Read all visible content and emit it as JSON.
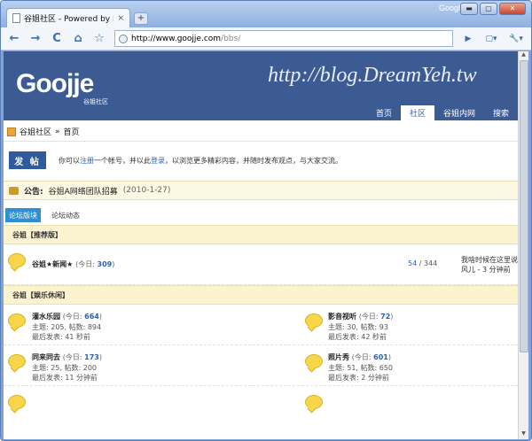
{
  "browser": {
    "tab_title": "谷姐社区 - Powered by Dis...",
    "tab_close": "×",
    "new_tab": "+",
    "brand": "Google",
    "window_buttons": {
      "minimize": "▬",
      "maximize": "▢",
      "close": "✕"
    },
    "url_host": "http://www.goojje.com",
    "url_path": "/bbs/",
    "buttons": {
      "back": "←",
      "forward": "→",
      "reload": "C",
      "home": "⌂",
      "star": "☆",
      "go": "▶",
      "page": "▢▾",
      "wrench": "🔧▾"
    }
  },
  "header": {
    "logo": "Goojje",
    "logo_sub": "谷姐社区",
    "blog_url": "http://blog.DreamYeh.tw",
    "nav": [
      {
        "label": "首页"
      },
      {
        "label": "社区"
      },
      {
        "label": "谷姐内网"
      },
      {
        "label": "搜索"
      }
    ]
  },
  "breadcrumb": {
    "root": "谷姐社区",
    "sep": "»",
    "current": "首页"
  },
  "intro": {
    "post_button": "发 帖",
    "pre": "你可以",
    "register": "注册",
    "mid1": "一个帐号，并以此",
    "login": "登录",
    "post": "，以浏览更多精彩内容，并随时发布观点，与大家交流。"
  },
  "announcement": {
    "label": "公告:",
    "text": "谷姐A网络团队招募",
    "date": "(2010-1-27)"
  },
  "board_tabs": [
    {
      "label": "论坛版块"
    },
    {
      "label": "论坛动态"
    }
  ],
  "sections": [
    {
      "title": "谷姐【推荐版】",
      "forums": [
        {
          "name": "谷姐★新闻★",
          "today_label": "(今日: ",
          "today": "309",
          "today_close": ")",
          "counts_a": "54",
          "counts_sep": " / ",
          "counts_b": "344",
          "last_title": "我啥时候在这里说",
          "last_by": "风儿 - 3 分钟前"
        }
      ]
    },
    {
      "title": "谷姐【娱乐休闲】",
      "forums": [
        {
          "name": "灌水乐园",
          "today_label": "(今日: ",
          "today": "664",
          "today_close": ")",
          "meta1": "主题: 205, 帖数: 894",
          "meta2": "最后发表: 41 秒前"
        },
        {
          "name": "影音视听",
          "today_label": "(今日: ",
          "today": "72",
          "today_close": ")",
          "meta1": "主题: 30, 帖数: 93",
          "meta2": "最后发表: 42 秒前"
        },
        {
          "name": "同来同去",
          "today_label": "(今日: ",
          "today": "173",
          "today_close": ")",
          "meta1": "主题: 25, 帖数: 200",
          "meta2": "最后发表: 11 分钟前"
        },
        {
          "name": "照片秀",
          "today_label": "(今日: ",
          "today": "601",
          "today_close": ")",
          "meta1": "主题: 51, 帖数: 650",
          "meta2": "最后发表: 2 分钟前"
        }
      ]
    }
  ]
}
